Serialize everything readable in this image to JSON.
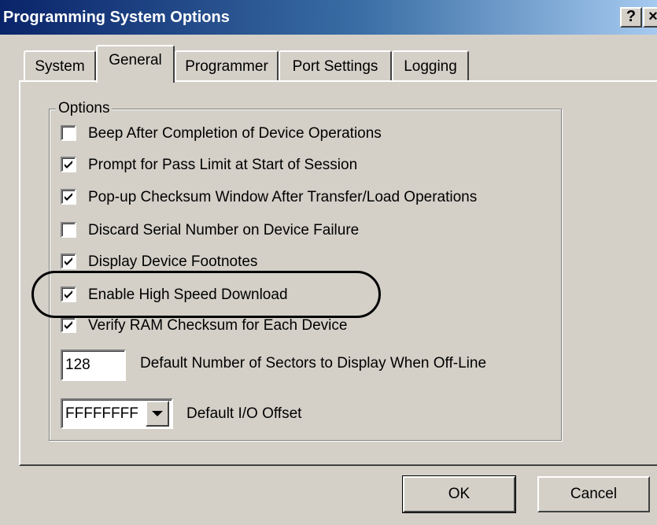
{
  "window": {
    "title": "Programming System Options",
    "help_button": "?",
    "close_button": "×"
  },
  "tabs": [
    {
      "label": "System",
      "active": false
    },
    {
      "label": "General",
      "active": true
    },
    {
      "label": "Programmer",
      "active": false
    },
    {
      "label": "Port Settings",
      "active": false
    },
    {
      "label": "Logging",
      "active": false
    }
  ],
  "options_group": {
    "label": "Options",
    "items": [
      {
        "label": "Beep After Completion of Device Operations",
        "checked": false
      },
      {
        "label": "Prompt for Pass Limit at Start of Session",
        "checked": true
      },
      {
        "label": "Pop-up Checksum Window After Transfer/Load Operations",
        "checked": true
      },
      {
        "label": "Discard Serial Number on Device Failure",
        "checked": false
      },
      {
        "label": "Display Device Footnotes",
        "checked": true
      },
      {
        "label": "Enable High Speed Download",
        "checked": true
      },
      {
        "label": "Verify RAM Checksum for Each Device",
        "checked": true
      }
    ],
    "sectors": {
      "value": "128",
      "label": "Default Number of Sectors to Display When Off-Line"
    },
    "io_offset": {
      "value": "FFFFFFFF",
      "label": "Default I/O Offset"
    }
  },
  "buttons": {
    "ok": "OK",
    "cancel": "Cancel"
  }
}
